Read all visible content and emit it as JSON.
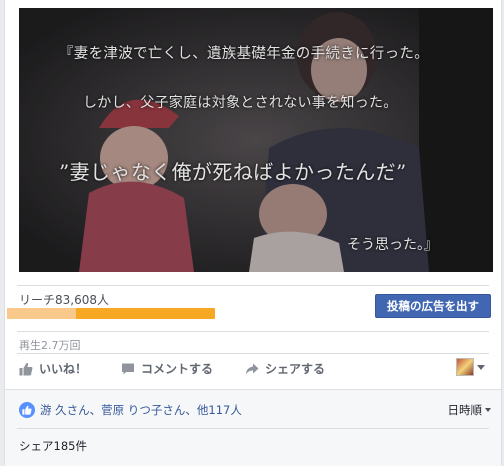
{
  "video": {
    "caption_line1": "『妻を津波で亡くし、遺族基礎年金の手続きに行った。",
    "caption_line2": "しかし、父子家庭は対象とされない事を知った。",
    "caption_line3": "”妻じゃなく俺が死ねばよかったんだ”",
    "caption_line4": "そう思った。』"
  },
  "stats": {
    "reach_label": "リーチ83,608人",
    "organic_fraction": 0.33,
    "boost_button_label": "投稿の広告を出す",
    "views_label": "再生2.7万回"
  },
  "actions": {
    "like_label": "いいね！",
    "comment_label": "コメントする",
    "share_label": "シェアする"
  },
  "engagement": {
    "likes_text": "游 久さん、菅原 りつ子さん、他117人",
    "sort_label": "日時順",
    "shares_text": "シェア185件"
  },
  "colors": {
    "accent": "#4267b2",
    "reach_paid": "#f7a823",
    "reach_organic": "#f8c98a"
  }
}
